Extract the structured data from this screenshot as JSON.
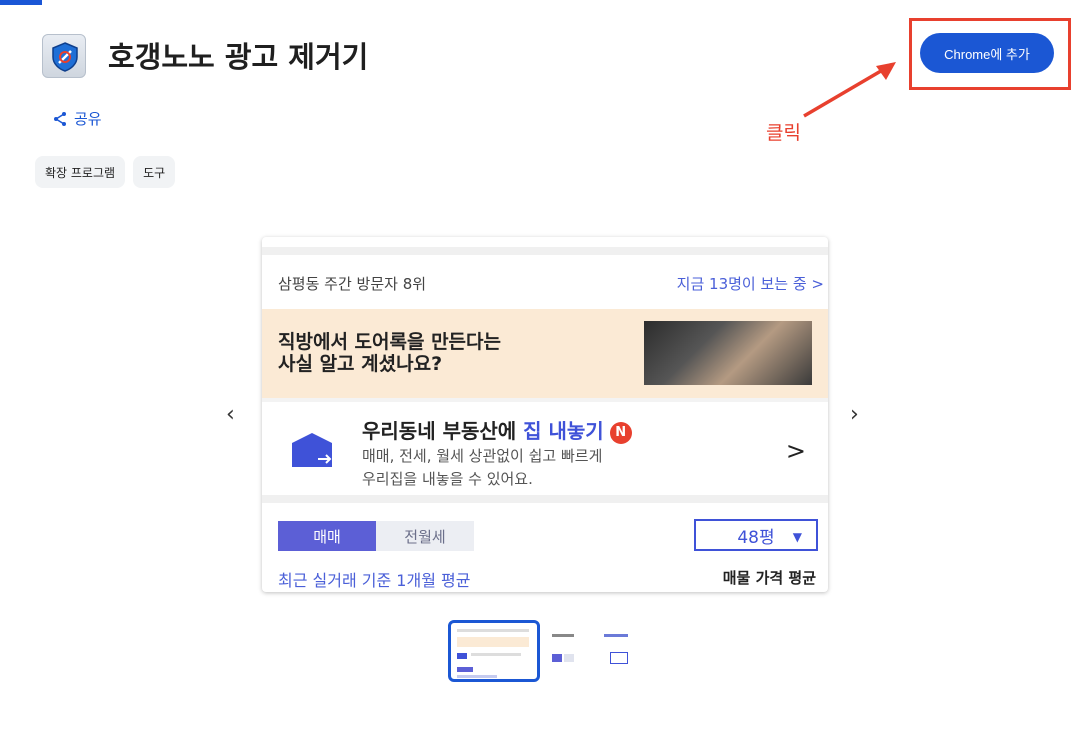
{
  "extension": {
    "title": "호갱노노 광고 제거기",
    "add_button": "Chrome에 추가",
    "share_label": "공유",
    "tags": [
      "확장 프로그램",
      "도구"
    ]
  },
  "annotation": {
    "click_label": "클릭",
    "color": "#e8402e"
  },
  "carousel": {
    "prev_label": "‹",
    "next_label": "›",
    "visitor_text": "삼평동 주간 방문자 8위",
    "visitor_link": "지금 13명이 보는 중 >",
    "promo_line1": "직방에서 도어록을 만든다는",
    "promo_line2": "사실 알고 계셨나요?",
    "sell_title_plain": "우리동네 부동산에 ",
    "sell_title_accent": "집 내놓기",
    "sell_badge": "N",
    "sell_desc_line1": "매매, 전세, 월세 상관없이 쉽고 빠르게",
    "sell_desc_line2": "우리집을 내놓을 수 있어요.",
    "sell_chevron": ">",
    "tab_active": "매매",
    "tab_inactive": "전월세",
    "size_value": "48평",
    "avg_note": "최근 실거래 기준 1개월 평균",
    "avg_label": "매물 가격 평균"
  },
  "colors": {
    "accent": "#1b57d4",
    "highlight": "#e8402e",
    "tab": "#5c5fd6"
  },
  "icons": [
    "shield-icon",
    "share-icon",
    "arrow-icon",
    "house-icon",
    "caret-down-icon"
  ]
}
